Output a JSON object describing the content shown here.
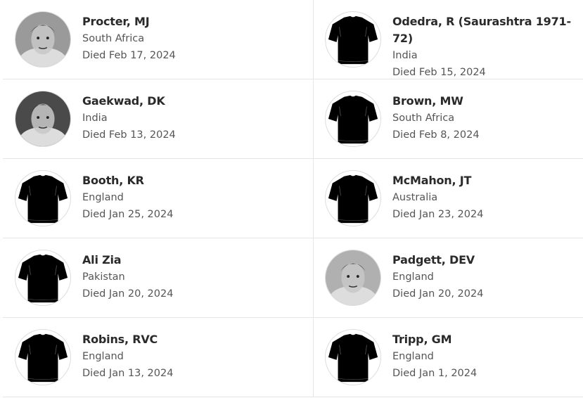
{
  "people": [
    {
      "name": "Procter, MJ",
      "country": "South Africa",
      "died": "Died Feb 17, 2024",
      "avatar": "photo",
      "tone": "#9a9a9a"
    },
    {
      "name": "Odedra, R (Saurashtra 1971-72)",
      "country": "India",
      "died": "Died Feb 15, 2024",
      "avatar": "jersey-icon"
    },
    {
      "name": "Gaekwad, DK",
      "country": "India",
      "died": "Died Feb 13, 2024",
      "avatar": "photo",
      "tone": "#4a4a4a"
    },
    {
      "name": "Brown, MW",
      "country": "South Africa",
      "died": "Died Feb 8, 2024",
      "avatar": "jersey-icon"
    },
    {
      "name": "Booth, KR",
      "country": "England",
      "died": "Died Jan 25, 2024",
      "avatar": "jersey-icon"
    },
    {
      "name": "McMahon, JT",
      "country": "Australia",
      "died": "Died Jan 23, 2024",
      "avatar": "jersey-icon"
    },
    {
      "name": "Ali Zia",
      "country": "Pakistan",
      "died": "Died Jan 20, 2024",
      "avatar": "jersey-icon"
    },
    {
      "name": "Padgett, DEV",
      "country": "England",
      "died": "Died Jan 20, 2024",
      "avatar": "photo",
      "tone": "#b0b0b0"
    },
    {
      "name": "Robins, RVC",
      "country": "England",
      "died": "Died Jan 13, 2024",
      "avatar": "jersey-icon"
    },
    {
      "name": "Tripp, GM",
      "country": "England",
      "died": "Died Jan 1, 2024",
      "avatar": "jersey-icon"
    }
  ]
}
